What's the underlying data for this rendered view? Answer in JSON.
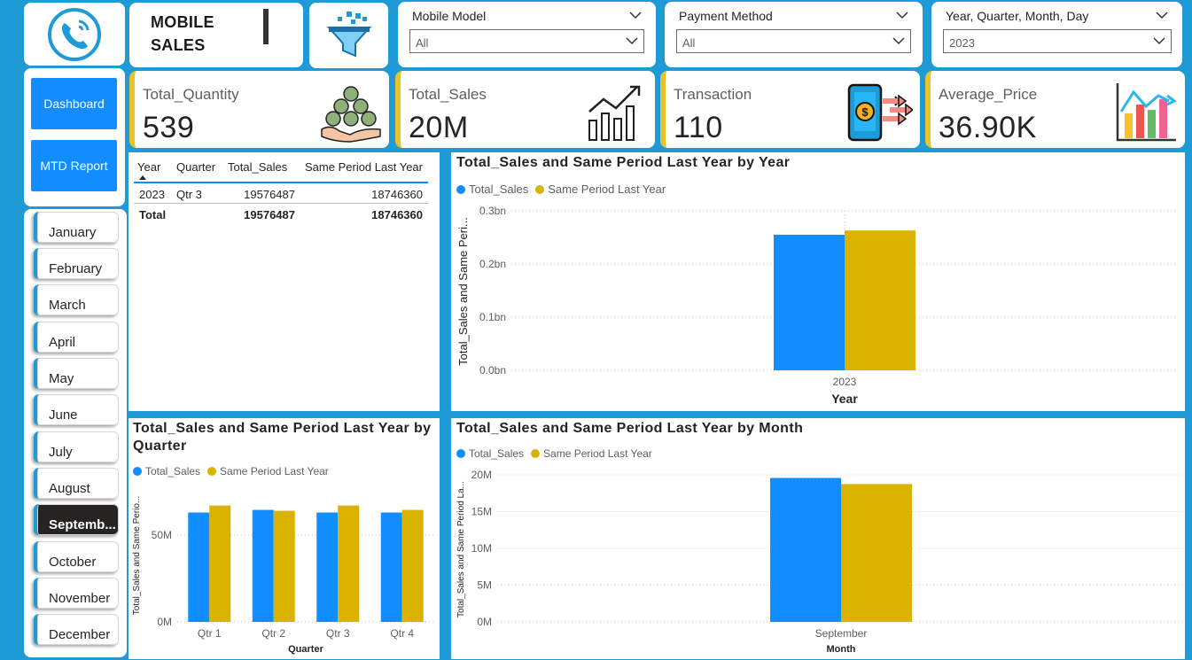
{
  "header": {
    "title_line1": "MOBILE",
    "title_line2": "SALES"
  },
  "slicers": [
    {
      "label": "Mobile Model",
      "value": "All"
    },
    {
      "label": "Payment Method",
      "value": "All"
    },
    {
      "label": "Year, Quarter, Month, Day",
      "value": "2023"
    }
  ],
  "nav": {
    "dashboard": "Dashboard",
    "mtd_report": "MTD Report"
  },
  "months": [
    "January",
    "February",
    "March",
    "April",
    "May",
    "June",
    "July",
    "August",
    "Septemb...",
    "October",
    "November",
    "December"
  ],
  "selected_month": "Septemb...",
  "kpis": [
    {
      "label": "Total_Quantity",
      "value": "539",
      "icon": "money-bags-hands-icon"
    },
    {
      "label": "Total_Sales",
      "value": "20M",
      "icon": "growth-bar-chart-icon"
    },
    {
      "label": "Transaction",
      "value": "110",
      "icon": "mobile-payment-icon"
    },
    {
      "label": "Average_Price",
      "value": "36.90K",
      "icon": "colored-bar-chart-icon"
    }
  ],
  "table": {
    "headers": [
      "Year",
      "Quarter",
      "Total_Sales",
      "Same Period Last Year"
    ],
    "rows": [
      [
        "2023",
        "Qtr 3",
        "19576487",
        "18746360"
      ]
    ],
    "total": [
      "Total",
      "",
      "19576487",
      "18746360"
    ]
  },
  "colors": {
    "total_sales": "#118dff",
    "same_period": "#d9b300",
    "background": "#1e9ad6"
  },
  "chart_data": [
    {
      "type": "bar",
      "title": "Total_Sales and Same Period Last Year by Year",
      "xlabel": "Year",
      "ylabel": "Total_Sales and Same Peri...",
      "categories": [
        "2023"
      ],
      "series": [
        {
          "name": "Total_Sales",
          "values": [
            0.255
          ]
        },
        {
          "name": "Same Period Last Year",
          "values": [
            0.263
          ]
        }
      ],
      "yticks": [
        "0.0bn",
        "0.1bn",
        "0.2bn",
        "0.3bn"
      ],
      "ylim": [
        0,
        0.3
      ]
    },
    {
      "type": "bar",
      "title_line1": "Total_Sales and Same Period Last Year by",
      "title_line2": "Quarter",
      "xlabel": "Quarter",
      "ylabel": "Total_Sales and Same Perio...",
      "categories": [
        "Qtr 1",
        "Qtr 2",
        "Qtr 3",
        "Qtr 4"
      ],
      "series": [
        {
          "name": "Total_Sales",
          "values": [
            63,
            64.5,
            63,
            63
          ]
        },
        {
          "name": "Same Period Last Year",
          "values": [
            67,
            64,
            67,
            64.5
          ]
        }
      ],
      "yticks": [
        "0M",
        "50M"
      ],
      "ylim": [
        0,
        75
      ]
    },
    {
      "type": "bar",
      "title": "Total_Sales and Same Period Last Year by Month",
      "xlabel": "Month",
      "ylabel": "Total_Sales and Same Period La...",
      "categories": [
        "September"
      ],
      "series": [
        {
          "name": "Total_Sales",
          "values": [
            19.58
          ]
        },
        {
          "name": "Same Period Last Year",
          "values": [
            18.75
          ]
        }
      ],
      "yticks": [
        "0M",
        "5M",
        "10M",
        "15M",
        "20M"
      ],
      "ylim": [
        0,
        20
      ]
    }
  ]
}
